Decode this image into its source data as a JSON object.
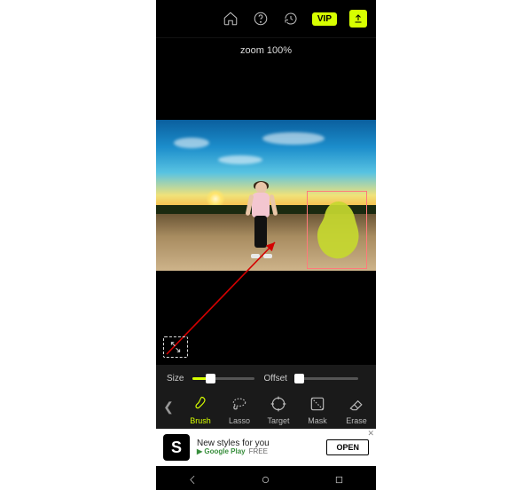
{
  "topbar": {
    "vip": "VIP"
  },
  "canvas": {
    "zoom_label": "zoom 100%"
  },
  "sliders": {
    "size": {
      "label": "Size",
      "percent": 28,
      "fill_style": "width:28%",
      "thumb_style": "left:calc(28% - 5px)"
    },
    "offset": {
      "label": "Offset",
      "percent": 4,
      "fill_style": "width:4%",
      "thumb_style": "left:calc(4% - 5px)"
    }
  },
  "tools": [
    {
      "id": "brush",
      "label": "Brush",
      "active": true
    },
    {
      "id": "lasso",
      "label": "Lasso",
      "active": false
    },
    {
      "id": "target",
      "label": "Target",
      "active": false
    },
    {
      "id": "mask",
      "label": "Mask",
      "active": false
    },
    {
      "id": "erase",
      "label": "Erase",
      "active": false
    }
  ],
  "ad": {
    "title": "New styles for you",
    "store": "▶ Google Play",
    "price": "FREE",
    "cta": "OPEN"
  },
  "colors": {
    "accent": "#d7ff00",
    "selection": "#ff7a7a",
    "annotation": "#d40000"
  }
}
